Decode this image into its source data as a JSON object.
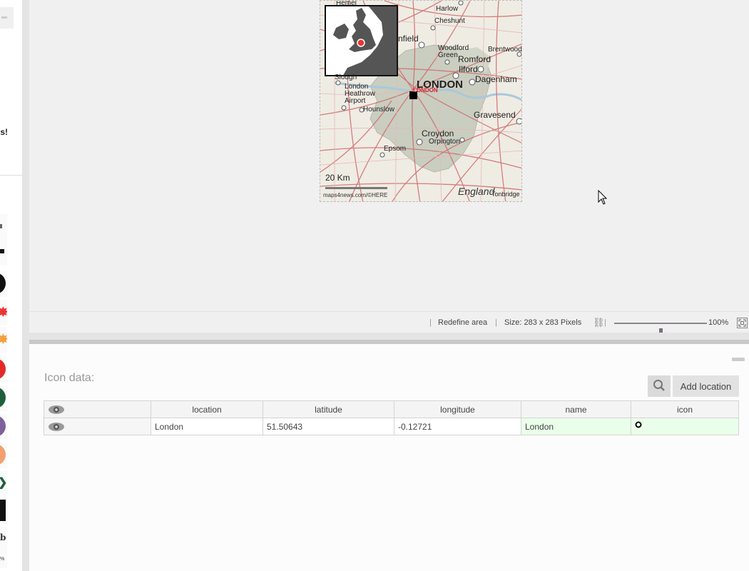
{
  "sidebar": {
    "partial_text": "s!",
    "icons": [
      "flag-icon",
      "black-circle-icon",
      "red-burst-icon",
      "orange-burst-icon",
      "red-circle-icon",
      "green-circle-icon",
      "purple-circle-icon",
      "orange-circle-icon",
      "green-arrow-icon",
      "black-rect-icon"
    ],
    "partial_letter": "b",
    "partial_small": "%"
  },
  "map": {
    "places": {
      "hemel": "Hemel",
      "harlow": "Harlow",
      "cheshunt": "Cheshunt",
      "enfield": "nfield",
      "brentwood": "Brentwood",
      "woodford": "Woodford",
      "green": "Green",
      "romford": "Romford",
      "ilford": "Ilford",
      "dagenham": "Dagenham",
      "london": "LONDON",
      "london_red": "LONDON",
      "slough": "Slough",
      "heathrow1": "London",
      "heathrow2": "Heathrow",
      "heathrow3": "Airport",
      "hounslow": "Hounslow",
      "gravesend": "Gravesend",
      "croydon": "Croydon",
      "orpington": "Orpington",
      "epsom": "Epsom",
      "england": "England",
      "tonbridge": "Tonbridge"
    },
    "scale": "20 Km",
    "credit": "maps4news.com/©HERE"
  },
  "statusbar": {
    "redefine": "Redefine area",
    "size": "Size: 283  x 283  Pixels",
    "zoom": "100%",
    "zoom_level": 0.5
  },
  "panel": {
    "title": "Icon data:",
    "add_button": "Add location",
    "columns": [
      "location",
      "latitude",
      "longitude",
      "name",
      "icon"
    ],
    "rows": [
      {
        "location": "London",
        "latitude": "51.50643",
        "longitude": "-0.12721",
        "name": "London",
        "icon": "circle-marker-icon"
      }
    ]
  },
  "colors": {
    "accent_green": "#eaffea",
    "marker_red": "#e33"
  }
}
